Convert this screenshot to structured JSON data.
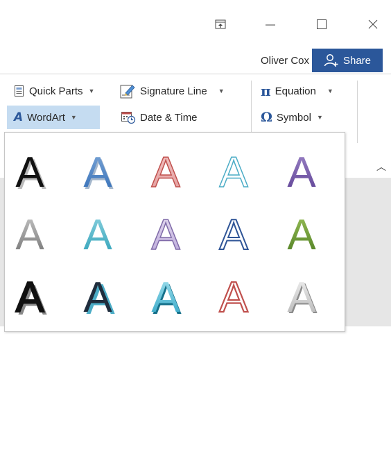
{
  "window": {
    "user_name": "Oliver Cox",
    "share_label": "Share",
    "icons": [
      "ribbon-display-options-icon",
      "minimize-icon",
      "maximize-icon",
      "close-icon"
    ]
  },
  "ribbon": {
    "quick_parts_label": "Quick Parts",
    "signature_line_label": "Signature Line",
    "equation_label": "Equation",
    "wordart_label": "WordArt",
    "date_time_label": "Date & Time",
    "symbol_label": "Symbol",
    "accent_color": "#2b579a"
  },
  "gallery": {
    "glyph": "A",
    "styles": [
      [
        "black-shadow",
        "blue-gradient",
        "red-outline",
        "cyan-outline",
        "purple-gradient"
      ],
      [
        "gray-gradient",
        "teal-reflection",
        "lavender-outline",
        "blue-outline",
        "green-bevel"
      ],
      [
        "black-heavy-shadow",
        "navy-shadow",
        "cyan-bevel",
        "red-outline-white",
        "silver-emboss"
      ]
    ]
  }
}
